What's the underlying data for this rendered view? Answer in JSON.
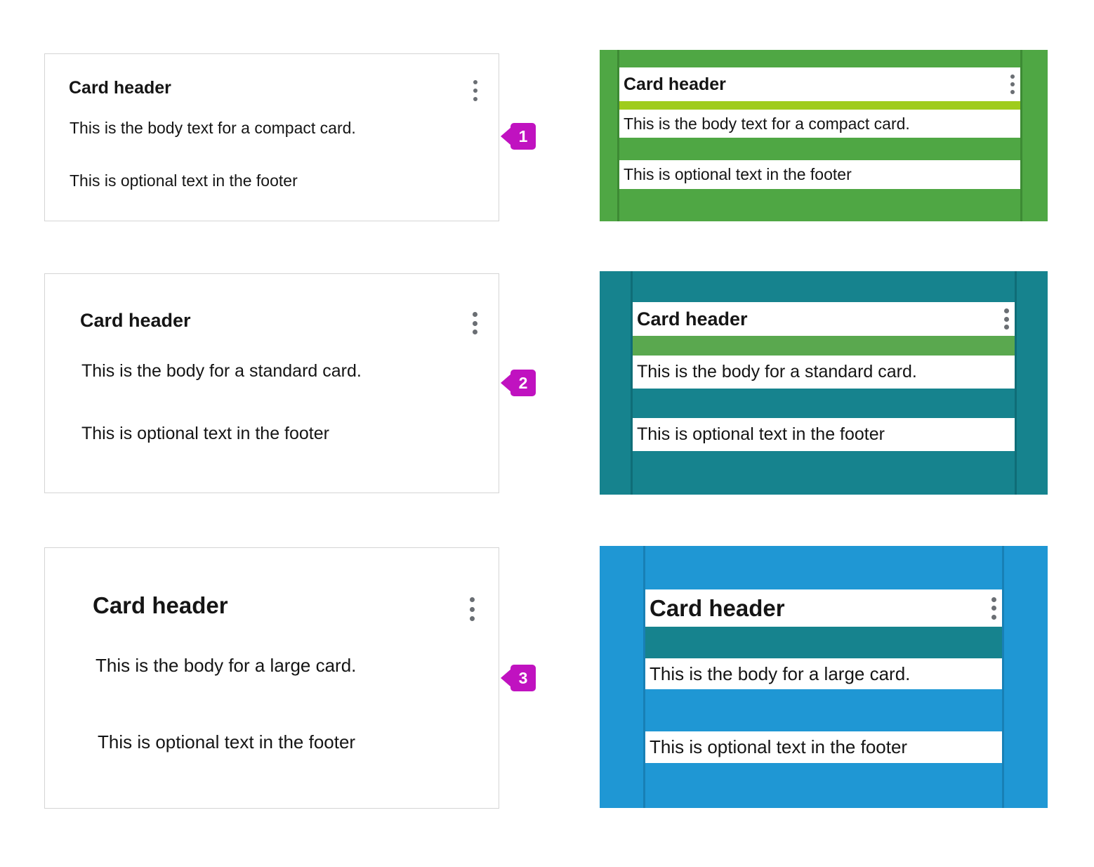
{
  "page": {
    "background": "#ffffff",
    "card_border_color": "#d5d5d5",
    "text_color": "#151515",
    "kebab_color": "#6a6e73",
    "callout_color": "#c012c0"
  },
  "cards": [
    {
      "variant": "compact",
      "marker": "1",
      "header": "Card header",
      "body": "This is the body text for a compact card.",
      "footer": "This is optional text in the footer",
      "menu_icon": "kebab-menu-icon",
      "fill": "#4fa744",
      "guide": "#3d8a34",
      "band": "#9fcc1d"
    },
    {
      "variant": "standard",
      "marker": "2",
      "header": "Card header",
      "body": "This is the body for a standard card.",
      "footer": "This is optional text in the footer",
      "menu_icon": "kebab-menu-icon",
      "fill": "#16838e",
      "guide": "#0f6d77",
      "band": "#5aa84f"
    },
    {
      "variant": "large",
      "marker": "3",
      "header": "Card header",
      "body": "This is the body for a large card.",
      "footer": "This is optional text in the footer",
      "menu_icon": "kebab-menu-icon",
      "fill": "#1f97d4",
      "guide": "#1880b5",
      "band": "#16838e"
    }
  ]
}
